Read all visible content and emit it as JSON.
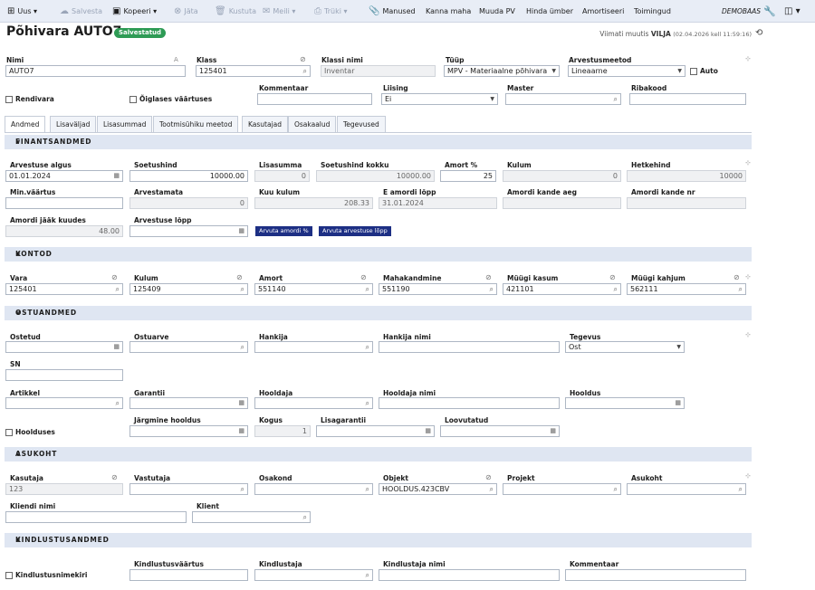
{
  "toolbar": {
    "new": "Uus",
    "save": "Salvesta",
    "copy": "Kopeeri",
    "cancel": "Jäta",
    "delete": "Kustuta",
    "mail": "Meili",
    "print": "Trüki",
    "attachments": "Manused",
    "write_off": "Kanna maha",
    "change_pv": "Muuda PV",
    "change_value": "Hinda ümber",
    "depreciate": "Amortiseeri",
    "actions": "Toimingud",
    "db": "DEMOBAAS"
  },
  "header": {
    "title": "Põhivara AUTO7",
    "status": "Salvestatud",
    "modified_prefix": "Viimati muutis",
    "modified_user": "VILJA",
    "modified_time": "(02.04.2026 kell 11:59:16)"
  },
  "top": {
    "nimi_label": "Nimi",
    "nimi": "AUTO7",
    "klass_label": "Klass",
    "klass": "125401",
    "klassi_nimi_label": "Klassi nimi",
    "klassi_nimi": "Inventar",
    "tyyp_label": "Tüüp",
    "tyyp": "MPV - Materiaalne põhivara",
    "arv_meetod_label": "Arvestusmeetod",
    "arv_meetod": "Lineaarne",
    "auto_label": "Auto",
    "kommentaar_label": "Kommentaar",
    "kommentaar": "",
    "liising_label": "Liising",
    "liising": "Ei",
    "master_label": "Master",
    "master": "",
    "ribakood_label": "Ribakood",
    "ribakood": "",
    "rendivara_label": "Rendivara",
    "oiglane_label": "Õiglases väärtuses"
  },
  "tabs": [
    "Andmed",
    "Lisaväljad",
    "Lisasummad",
    "Tootmisühiku meetod",
    "Kasutajad",
    "Osakaalud",
    "Tegevused"
  ],
  "sections": {
    "finants": "FINANTSANDMED",
    "kontod": "KONTOD",
    "ostu": "OSTUANDMED",
    "asukoht": "ASUKOHT",
    "kindlustus": "KINDLUSTUSANDMED"
  },
  "finants": {
    "arv_algus_label": "Arvestuse algus",
    "arv_algus": "01.01.2024",
    "soetushind_label": "Soetushind",
    "soetushind": "10000.00",
    "lisasumma_label": "Lisasumma",
    "lisasumma": "0",
    "soet_kokku_label": "Soetushind kokku",
    "soet_kokku": "10000.00",
    "amort_pct_label": "Amort %",
    "amort_pct": "25",
    "kulum_label": "Kulum",
    "kulum": "0",
    "hetkehind_label": "Hetkehind",
    "hetkehind": "10000",
    "min_label": "Min.väärtus",
    "min": "",
    "arvestamata_label": "Arvestamata",
    "arvestamata": "0",
    "kuu_kulum_label": "Kuu kulum",
    "kuu_kulum": "208.33",
    "e_amordi_lopp_label": "E amordi lõpp",
    "e_amordi_lopp": "31.01.2024",
    "amordi_kande_aeg_label": "Amordi kande aeg",
    "amordi_kande_aeg": "",
    "amordi_kande_nr_label": "Amordi kande nr",
    "amordi_kande_nr": "",
    "jaak_kuudes_label": "Amordi jääk kuudes",
    "jaak_kuudes": "48.00",
    "arv_lopp_label": "Arvestuse lõpp",
    "arv_lopp": "",
    "btn_amort": "Arvuta amordi %",
    "btn_lopp": "Arvuta arvestuse lõpp"
  },
  "kontod": {
    "vara_label": "Vara",
    "vara": "125401",
    "kulum_label": "Kulum",
    "kulum": "125409",
    "amort_label": "Amort",
    "amort": "551140",
    "mahakandmine_label": "Mahakandmine",
    "mahakandmine": "551190",
    "myygi_kasum_label": "Müügi kasum",
    "myygi_kasum": "421101",
    "myygi_kahjum_label": "Müügi kahjum",
    "myygi_kahjum": "562111"
  },
  "ostu": {
    "ostetud_label": "Ostetud",
    "ostuarve_label": "Ostuarve",
    "hankija_label": "Hankija",
    "hankija_nimi_label": "Hankija nimi",
    "tegevus_label": "Tegevus",
    "tegevus": "Ost",
    "sn_label": "SN",
    "artikkel_label": "Artikkel",
    "garantii_label": "Garantii",
    "hooldaja_label": "Hooldaja",
    "hooldaja_nimi_label": "Hooldaja nimi",
    "hooldus_label": "Hooldus",
    "hoolduses_label": "Hoolduses",
    "jargmine_label": "Järgmine hooldus",
    "kogus_label": "Kogus",
    "kogus": "1",
    "lisagarantii_label": "Lisagarantii",
    "loovutatud_label": "Loovutatud"
  },
  "asukoht": {
    "kasutaja_label": "Kasutaja",
    "kasutaja": "123",
    "vastutaja_label": "Vastutaja",
    "osakond_label": "Osakond",
    "objekt_label": "Objekt",
    "objekt": "HOOLDUS.423CBV",
    "projekt_label": "Projekt",
    "asukoht_label": "Asukoht",
    "kliendi_nimi_label": "Kliendi nimi",
    "klient_label": "Klient"
  },
  "kindlustus": {
    "nimekiri_label": "Kindlustusnimekiri",
    "vaartus_label": "Kindlustusväärtus",
    "kindlustaja_label": "Kindlustaja",
    "kindlustaja_nimi_label": "Kindlustaja nimi",
    "kommentaar_label": "Kommentaar"
  }
}
